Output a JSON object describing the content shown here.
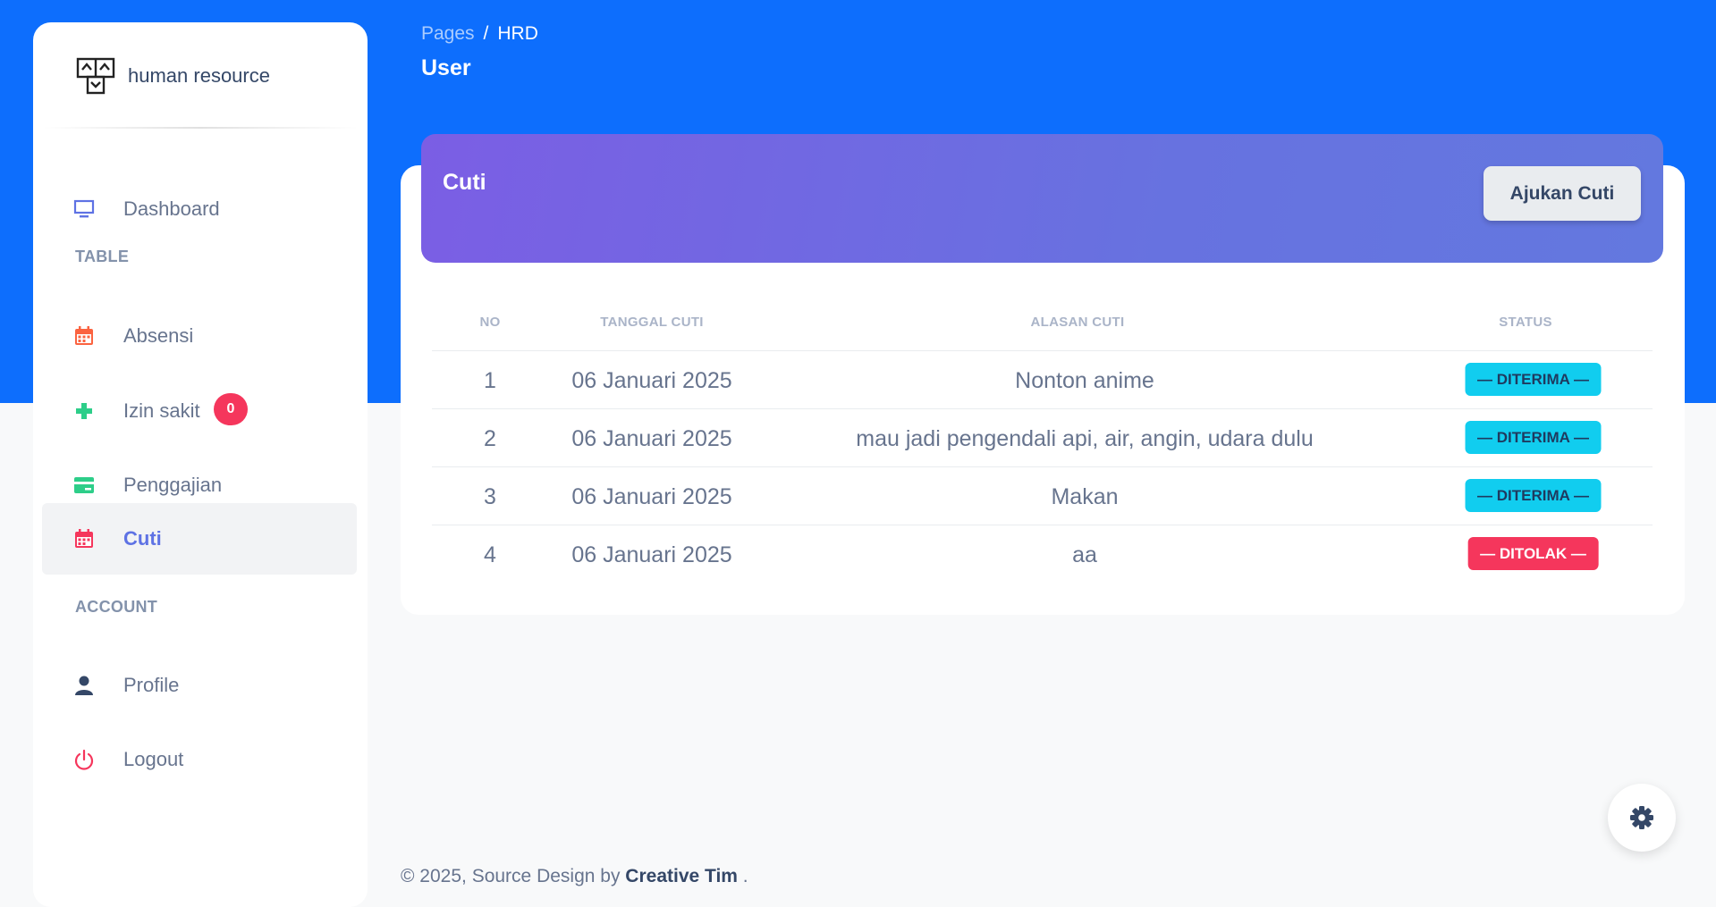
{
  "brand": {
    "name": "human resource"
  },
  "sidebar": {
    "items": [
      {
        "label": "Dashboard",
        "icon": "monitor-icon"
      },
      {
        "label": "Absensi",
        "icon": "calendar-icon"
      },
      {
        "label": "Izin sakit",
        "icon": "plus-icon",
        "badge": "0"
      },
      {
        "label": "Penggajian",
        "icon": "credit-card-icon"
      },
      {
        "label": "Cuti",
        "icon": "calendar-icon",
        "active": true
      },
      {
        "label": "Profile",
        "icon": "user-icon"
      },
      {
        "label": "Logout",
        "icon": "power-icon"
      }
    ],
    "sections": {
      "table": "TABLE",
      "account": "ACCOUNT"
    }
  },
  "breadcrumb": {
    "parent": "Pages",
    "separator": "/",
    "current": "HRD"
  },
  "page": {
    "title": "User"
  },
  "card": {
    "title": "Cuti",
    "apply_button": "Ajukan Cuti",
    "columns": [
      "NO",
      "TANGGAL CUTI",
      "ALASAN CUTI",
      "STATUS"
    ],
    "rows": [
      {
        "no": "1",
        "date": "06 Januari 2025",
        "reason": "Nonton anime",
        "status": "— DITERIMA —"
      },
      {
        "no": "2",
        "date": "06 Januari 2025",
        "reason": "mau jadi pengendali api, air, angin, udara dulu",
        "status": "— DITERIMA —"
      },
      {
        "no": "3",
        "date": "06 Januari 2025",
        "reason": "Makan",
        "status": "— DITERIMA —"
      },
      {
        "no": "4",
        "date": "06 Januari 2025",
        "reason": "aa",
        "status": "— DITOLAK —"
      }
    ]
  },
  "footer": {
    "text": "© 2025, Source Design by ",
    "link": "Creative Tim",
    "suffix": " ."
  },
  "colors": {
    "primary": "#0d6efd",
    "accent": "#5e72e4",
    "success_badge": "#11cdef",
    "danger_badge": "#f5365c"
  }
}
